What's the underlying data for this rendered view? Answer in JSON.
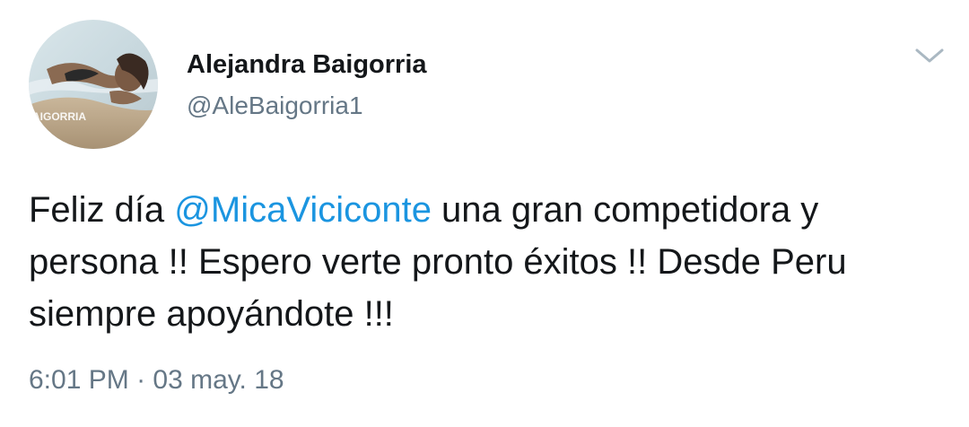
{
  "author": {
    "display_name": "Alejandra Baigorria",
    "handle": "@AleBaigorria1",
    "avatar_watermark": "AIGORRIA"
  },
  "tweet": {
    "text_before": "Feliz día ",
    "mention": "@MicaViciconte",
    "text_after": " una gran competidora y persona !! Espero verte pronto éxitos !! Desde Peru siempre apoyándote !!!",
    "time": "6:01 PM",
    "separator": " · ",
    "date": "03 may. 18"
  },
  "icons": {
    "menu": "chevron-down-icon"
  },
  "colors": {
    "link": "#1b95e0",
    "secondary_text": "#657786",
    "primary_text": "#14171a",
    "caret": "#aab8c2"
  }
}
